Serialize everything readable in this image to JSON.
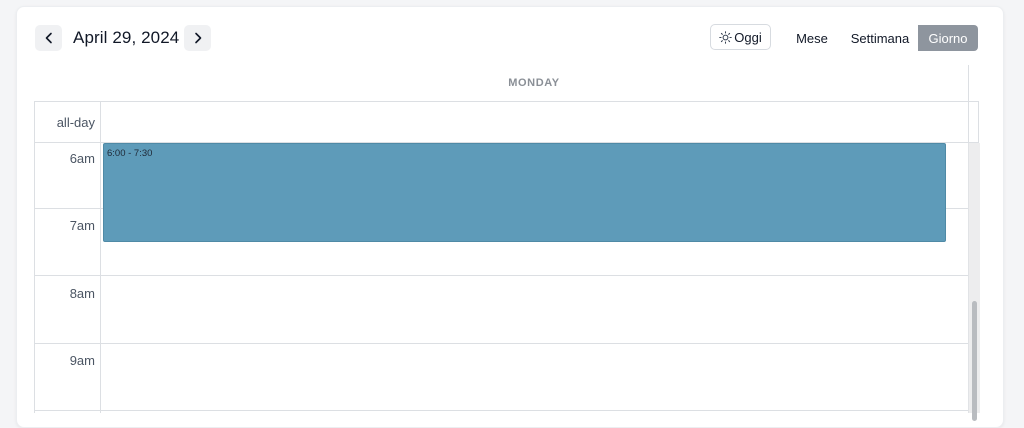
{
  "header": {
    "date_title": "April 29, 2024",
    "prev_icon": "chevron-left-icon",
    "next_icon": "chevron-right-icon",
    "today_icon": "sun-icon",
    "today_label": "Oggi",
    "views": [
      {
        "label": "Mese",
        "active": false
      },
      {
        "label": "Settimana",
        "active": false
      },
      {
        "label": "Giorno",
        "active": true
      }
    ]
  },
  "calendar": {
    "day_name": "MONDAY",
    "all_day_label": "all-day",
    "hours": [
      "6am",
      "7am",
      "8am",
      "9am"
    ],
    "events": [
      {
        "time": "6:00 - 7:30",
        "color": "#5e9bb9"
      }
    ]
  }
}
